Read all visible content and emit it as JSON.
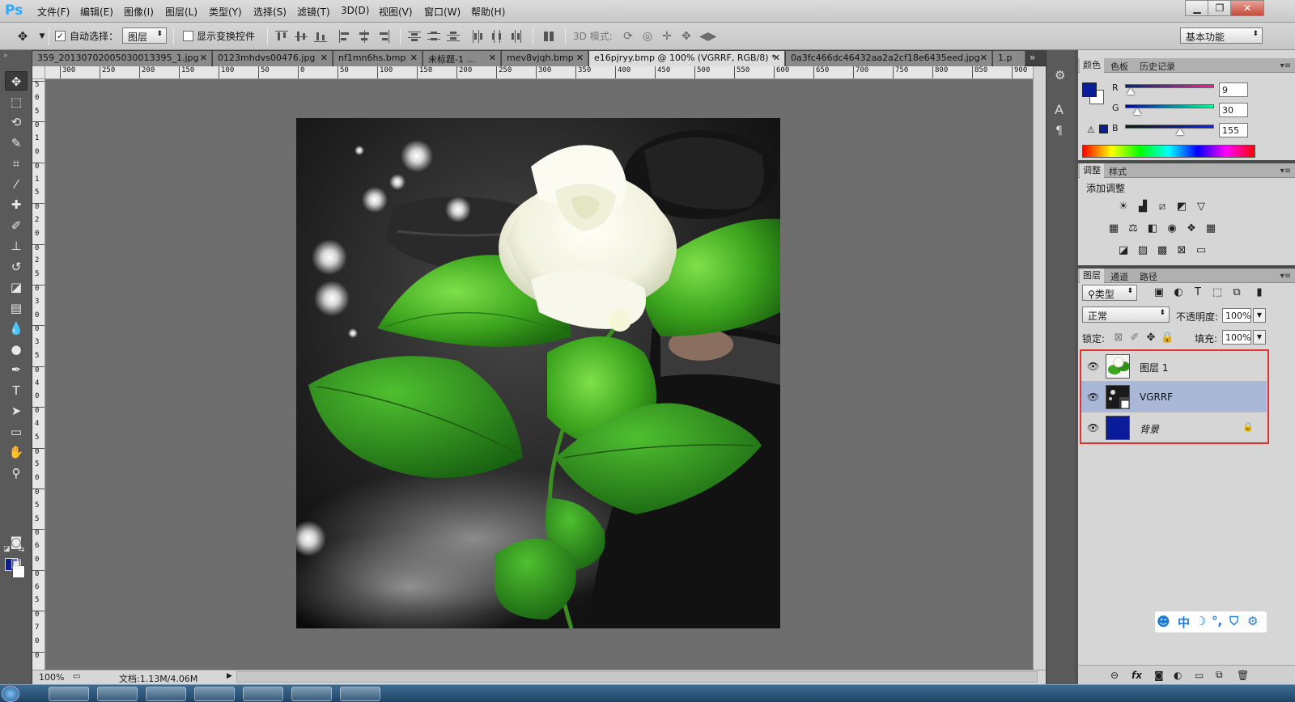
{
  "app": {
    "logo": "Ps"
  },
  "menu": [
    "文件(F)",
    "编辑(E)",
    "图像(I)",
    "图层(L)",
    "类型(Y)",
    "选择(S)",
    "滤镜(T)",
    "3D(D)",
    "视图(V)",
    "窗口(W)",
    "帮助(H)"
  ],
  "window_controls": {
    "minimize": "▁",
    "restore": "❐",
    "close": "✕"
  },
  "options": {
    "auto_select_checked": true,
    "auto_select_label": "自动选择：",
    "auto_select_mode": "图层",
    "show_transform_checked": false,
    "show_transform_label": "显示变换控件",
    "mode_3d_label": "3D 模式:",
    "workspace": "基本功能"
  },
  "tabs": [
    {
      "label": "359_20130702005030013395_1.jpg",
      "active": false
    },
    {
      "label": "0123mhdvs00476.jpg",
      "active": false
    },
    {
      "label": "nf1mn6hs.bmp",
      "active": false
    },
    {
      "label": "未标题-1 ...",
      "active": false
    },
    {
      "label": "mev8vjqh.bmp",
      "active": false
    },
    {
      "label": "e16pjryy.bmp @ 100% (VGRRF, RGB/8) *",
      "active": true
    },
    {
      "label": "0a3fc466dc46432aa2a2cf18e6435eed.jpg",
      "active": false
    },
    {
      "label": "1.p",
      "active": false
    }
  ],
  "tabs_overflow": "»",
  "ruler_h": [
    "300",
    "250",
    "200",
    "150",
    "100",
    "50",
    "0",
    "50",
    "100",
    "150",
    "200",
    "250",
    "300",
    "350",
    "400",
    "450",
    "500",
    "550",
    "600",
    "650",
    "700",
    "750",
    "800",
    "850",
    "900"
  ],
  "ruler_v": [
    "5",
    "0",
    "5",
    "0",
    "1",
    "0",
    "0",
    "1",
    "5",
    "0",
    "2",
    "0",
    "0",
    "2",
    "5",
    "0",
    "3",
    "0",
    "0",
    "3",
    "5",
    "0",
    "4",
    "0",
    "0",
    "4",
    "5",
    "0",
    "5",
    "0",
    "0",
    "5",
    "5",
    "0",
    "6",
    "0",
    "0",
    "6",
    "5",
    "0",
    "7",
    "0",
    "0"
  ],
  "tools": [
    {
      "name": "move-tool",
      "glyph": "✥"
    },
    {
      "name": "marquee-tool",
      "glyph": "⬚"
    },
    {
      "name": "lasso-tool",
      "glyph": "⟲"
    },
    {
      "name": "quick-select-tool",
      "glyph": "✎"
    },
    {
      "name": "crop-tool",
      "glyph": "⌗"
    },
    {
      "name": "eyedropper-tool",
      "glyph": "⁄"
    },
    {
      "name": "healing-tool",
      "glyph": "✚"
    },
    {
      "name": "brush-tool",
      "glyph": "✐"
    },
    {
      "name": "stamp-tool",
      "glyph": "⊥"
    },
    {
      "name": "history-brush-tool",
      "glyph": "↺"
    },
    {
      "name": "eraser-tool",
      "glyph": "◪"
    },
    {
      "name": "gradient-tool",
      "glyph": "▤"
    },
    {
      "name": "blur-tool",
      "glyph": "💧"
    },
    {
      "name": "dodge-tool",
      "glyph": "●"
    },
    {
      "name": "pen-tool",
      "glyph": "✒"
    },
    {
      "name": "type-tool",
      "glyph": "T"
    },
    {
      "name": "path-select-tool",
      "glyph": "➤"
    },
    {
      "name": "shape-tool",
      "glyph": "▭"
    },
    {
      "name": "hand-tool",
      "glyph": "✋"
    },
    {
      "name": "zoom-tool",
      "glyph": "⚲"
    }
  ],
  "colors": {
    "foreground": "#0b1c9b",
    "background": "#ffffff"
  },
  "status": {
    "zoom": "100%",
    "doc": "文档:1.13M/4.06M"
  },
  "color_panel": {
    "tabs": [
      "颜色",
      "色板",
      "历史记录"
    ],
    "r_label": "R",
    "g_label": "G",
    "b_label": "B",
    "r": "9",
    "g": "30",
    "b": "155"
  },
  "adjust_panel": {
    "tabs": [
      "调整",
      "样式"
    ],
    "title": "添加调整"
  },
  "layers_panel": {
    "tabs": [
      "图层",
      "通道",
      "路径"
    ],
    "filter": "类型",
    "blend_mode": "正常",
    "opacity_label": "不透明度:",
    "opacity": "100%",
    "lock_label": "锁定:",
    "fill_label": "填充:",
    "fill": "100%",
    "layers": [
      {
        "name": "图层 1",
        "selected": false,
        "locked": false
      },
      {
        "name": "VGRRF",
        "selected": true,
        "locked": false
      },
      {
        "name": "背景",
        "selected": false,
        "locked": true
      }
    ]
  },
  "ime": {
    "label": "中"
  }
}
